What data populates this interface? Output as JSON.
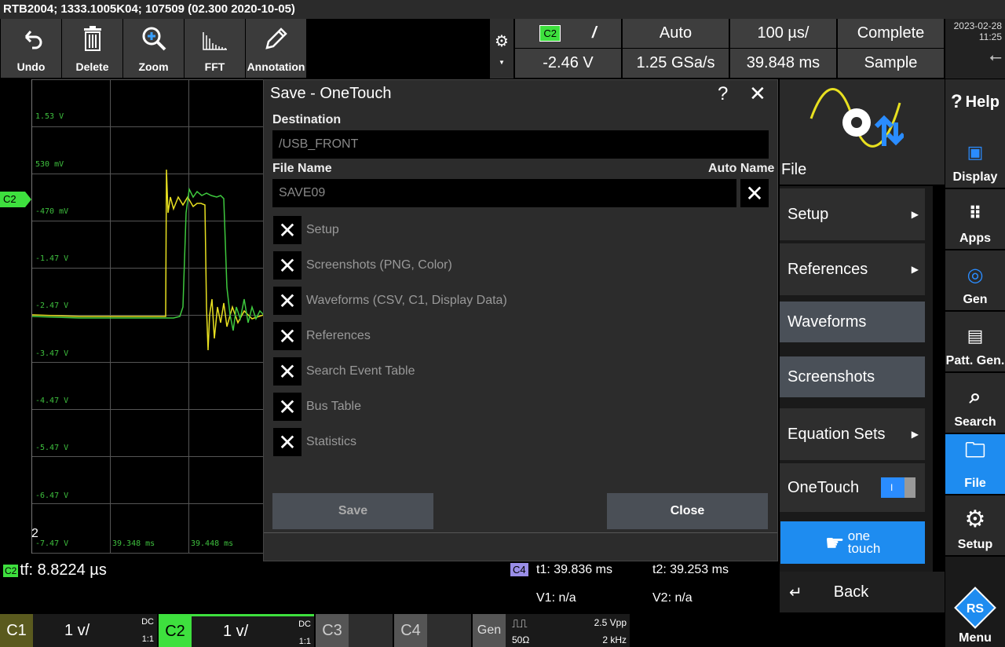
{
  "title_bar": "RTB2004; 1333.1005K04; 107509 (02.300 2020-10-05)",
  "toolbar": {
    "undo": "Undo",
    "delete": "Delete",
    "zoom": "Zoom",
    "fft": "FFT",
    "annotation": "Annotation"
  },
  "acq": {
    "channel_badge": "C2",
    "trigger_slope": "/",
    "trigger_mode": "Auto",
    "timebase": "100 µs/",
    "status": "Complete",
    "trigger_level": "-2.46 V",
    "sample_rate": "1.25 GSa/s",
    "position": "39.848 ms",
    "acq_mode": "Sample"
  },
  "clock": {
    "date": "2023-02-28",
    "time": "11:25"
  },
  "scope": {
    "y_labels": [
      "1.53 V",
      "530 mV",
      "-470 mV",
      "-1.47 V",
      "-2.47 V",
      "-3.47 V",
      "-4.47 V",
      "-5.47 V",
      "-6.47 V",
      "-7.47 V"
    ],
    "x_labels": [
      "39.348 ms",
      "39.448 ms"
    ],
    "ch_marker": "C2",
    "bottom_marker": "2"
  },
  "dialog": {
    "title": "Save - OneTouch",
    "help": "?",
    "close_x": "✕",
    "destination_label": "Destination",
    "destination_value": "/USB_FRONT",
    "filename_label": "File Name",
    "autoname_label": "Auto Name",
    "filename_value": "SAVE09",
    "autoname_check": "✕",
    "checks": [
      {
        "mark": "✕",
        "label": "Setup"
      },
      {
        "mark": "✕",
        "label": "Screenshots (PNG, Color)"
      },
      {
        "mark": "✕",
        "label": "Waveforms (CSV, C1, Display Data)"
      },
      {
        "mark": "✕",
        "label": "References"
      },
      {
        "mark": "✕",
        "label": "Search Event Table"
      },
      {
        "mark": "✕",
        "label": "Bus Table"
      },
      {
        "mark": "✕",
        "label": "Statistics"
      }
    ],
    "save_button": "Save",
    "close_button": "Close"
  },
  "file_menu": {
    "header": "File",
    "items": [
      {
        "label": "Setup",
        "arrow": "▶"
      },
      {
        "label": "References",
        "arrow": "▶"
      },
      {
        "label": "Waveforms",
        "arrow": ""
      },
      {
        "label": "Screenshots",
        "arrow": ""
      },
      {
        "label": "Equation Sets",
        "arrow": "▶"
      }
    ],
    "onetouch_label": "OneTouch",
    "onetouch_toggle": "I",
    "onetouch_btn_line1": "one",
    "onetouch_btn_line2": "touch",
    "back": "Back"
  },
  "right_bar": {
    "help": "Help",
    "display": "Display",
    "apps": "Apps",
    "gen": "Gen",
    "patt": "Patt. Gen.",
    "search": "Search",
    "file": "File",
    "setup": "Setup",
    "menu": "Menu"
  },
  "measure": {
    "ch": "C2",
    "tf": "tf: 8.8224 µs"
  },
  "cursor": {
    "ch": "C4",
    "t1": "t1: 39.836 ms",
    "t2": "t2: 39.253 ms",
    "v1": "V1: n/a",
    "v2": "V2: n/a"
  },
  "channels": {
    "c1": {
      "name": "C1",
      "scale": "1 v/",
      "coupling": "DC",
      "probe": "1:1"
    },
    "c2": {
      "name": "C2",
      "scale": "1 v/",
      "coupling": "DC",
      "probe": "1:1"
    },
    "c3": {
      "name": "C3"
    },
    "c4": {
      "name": "C4"
    },
    "gen": {
      "name": "Gen",
      "vpp": "2.5 Vpp",
      "imp": "50Ω",
      "freq": "2 kHz"
    }
  }
}
